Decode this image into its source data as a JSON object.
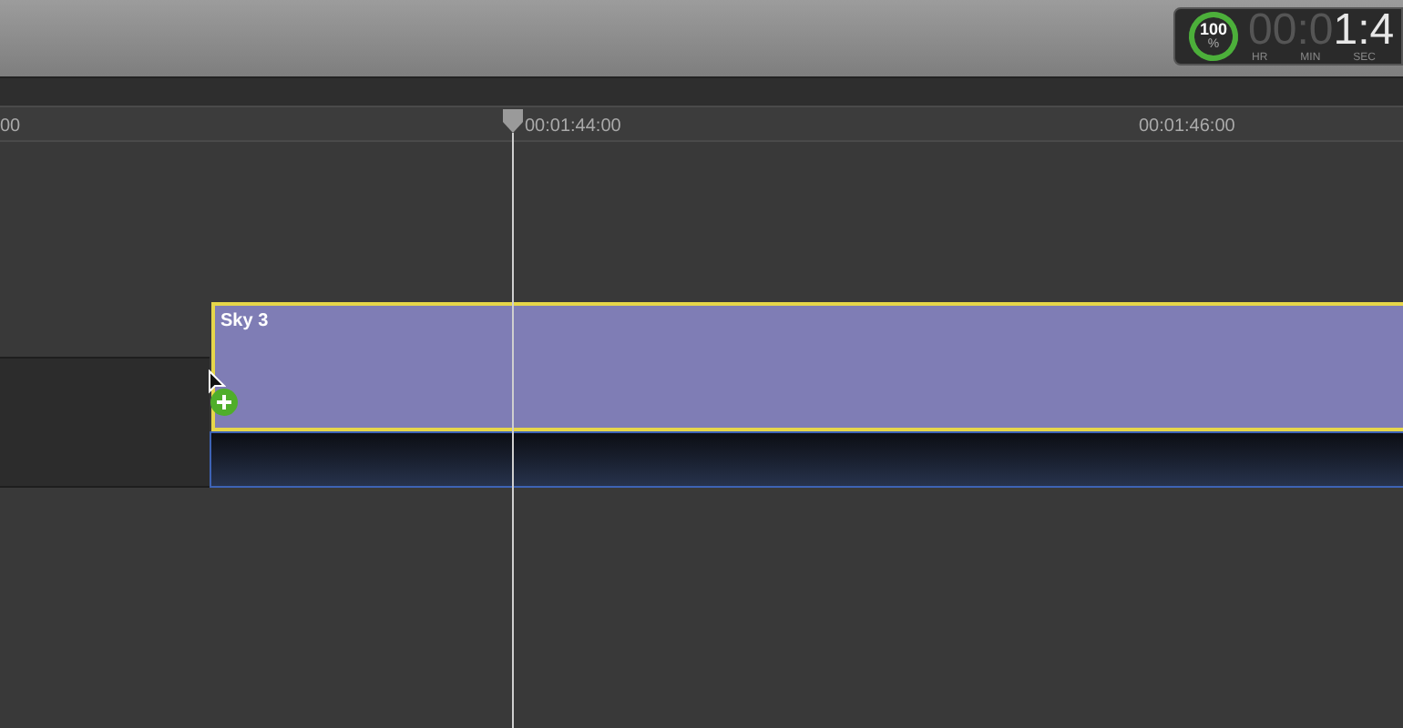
{
  "toolbar": {
    "render_progress": {
      "reading": "100",
      "unit": "%",
      "level": 1
    },
    "timecode": {
      "dim_digits": "00:0",
      "bright_digits": "1:4",
      "units": [
        "HR",
        "MIN",
        "SEC"
      ]
    }
  },
  "ruler": {
    "labels": [
      "00",
      "00:01:44:00",
      "00:01:46:00"
    ]
  },
  "clip": {
    "title": "Sky 3",
    "selected": true
  }
}
